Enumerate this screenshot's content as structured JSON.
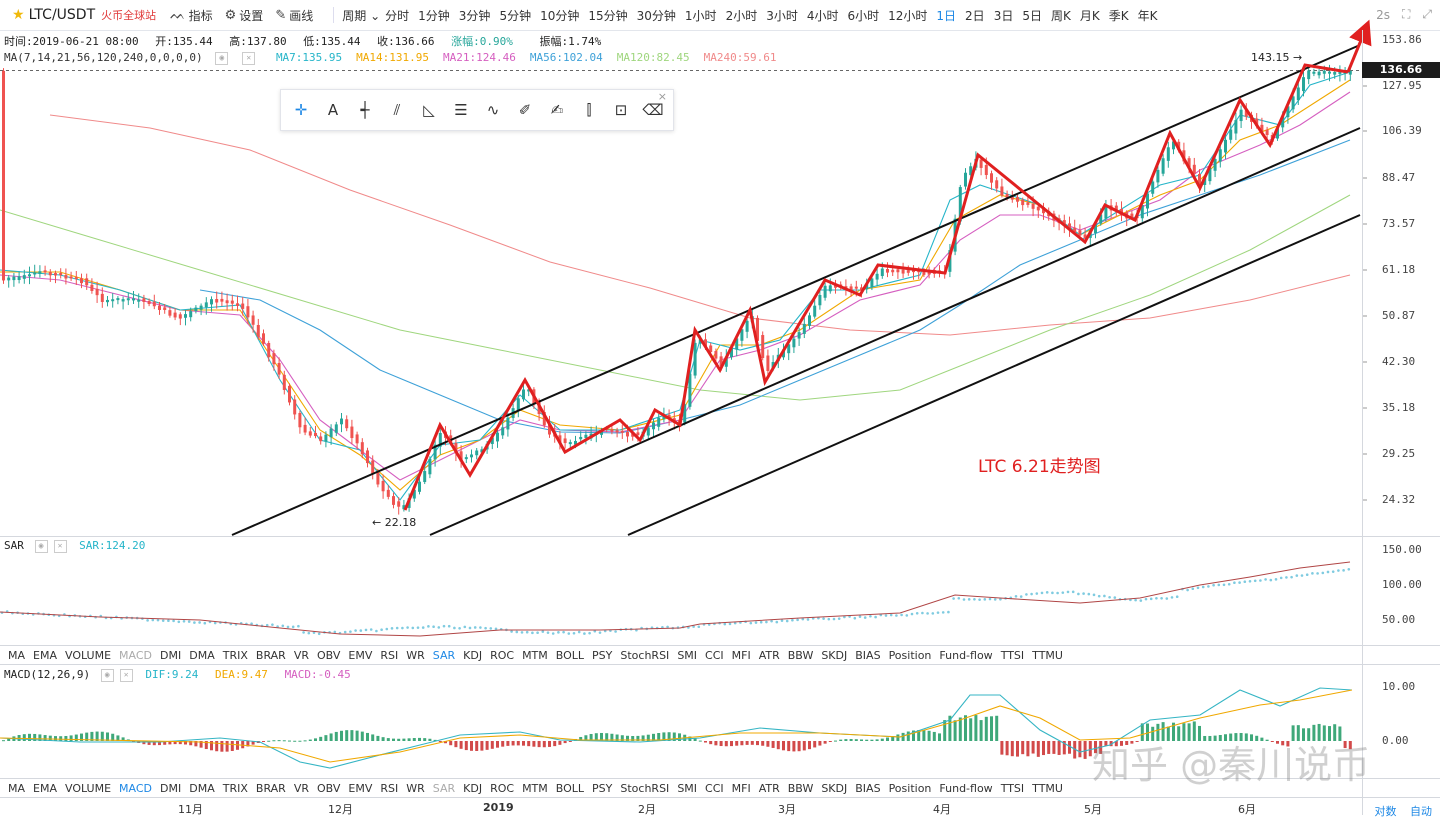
{
  "header": {
    "symbol": "LTC/USDT",
    "exchange": "火币全球站",
    "tools": [
      {
        "icon": "indicator-icon",
        "label": "指标"
      },
      {
        "icon": "gear-icon",
        "label": "设置"
      },
      {
        "icon": "pen-icon",
        "label": "画线"
      }
    ],
    "period_label": "周期",
    "intervals": [
      "分时",
      "1分钟",
      "3分钟",
      "5分钟",
      "10分钟",
      "15分钟",
      "30分钟",
      "1小时",
      "2小时",
      "3小时",
      "4小时",
      "6小时",
      "12小时",
      "1日",
      "2日",
      "3日",
      "5日",
      "周K",
      "月K",
      "季K",
      "年K"
    ],
    "active_interval": "1日",
    "refresh": "2s"
  },
  "ohlc": {
    "time": "时间:2019-06-21 08:00",
    "open": "开:135.44",
    "high": "高:137.80",
    "low": "低:135.44",
    "close": "收:136.66",
    "change": "涨幅:0.90%",
    "amplitude": "振幅:1.74%"
  },
  "ma_legend": {
    "params": "MA(7,14,21,56,120,240,0,0,0,0)",
    "items": [
      {
        "label": "MA7:135.95",
        "color": "#26b5c9"
      },
      {
        "label": "MA14:131.95",
        "color": "#f0a800"
      },
      {
        "label": "MA21:124.46",
        "color": "#d55fc0"
      },
      {
        "label": "MA56:102.04",
        "color": "#3ea1d8"
      },
      {
        "label": "MA120:82.45",
        "color": "#9fd67e"
      },
      {
        "label": "MA240:59.61",
        "color": "#f08a8a"
      }
    ]
  },
  "price_axis": [
    "153.86",
    "127.95",
    "106.39",
    "88.47",
    "73.57",
    "61.18",
    "50.87",
    "42.30",
    "35.18",
    "29.25",
    "24.32"
  ],
  "current_price": "136.66",
  "high_marker": "143.15 →",
  "low_marker": "← 22.18",
  "annotation": "LTC 6.21走势图",
  "sar": {
    "name": "SAR",
    "value_label": "SAR:124.20",
    "axis": [
      "150.00",
      "100.00",
      "50.00"
    ]
  },
  "macd": {
    "params": "MACD(12,26,9)",
    "dif": "DIF:9.24",
    "dea": "DEA:9.47",
    "macd": "MACD:-0.45",
    "axis": [
      "10.00",
      "0.00"
    ]
  },
  "indicator_tabs": [
    "MA",
    "EMA",
    "VOLUME",
    "MACD",
    "DMI",
    "DMA",
    "TRIX",
    "BRAR",
    "VR",
    "OBV",
    "EMV",
    "RSI",
    "WR",
    "SAR",
    "KDJ",
    "ROC",
    "MTM",
    "BOLL",
    "PSY",
    "StochRSI",
    "SMI",
    "CCI",
    "MFI",
    "ATR",
    "BBW",
    "SKDJ",
    "BIAS",
    "Position",
    "Fund-flow",
    "TTSI",
    "TTMU"
  ],
  "time_axis": [
    "11月",
    "12月",
    "2019",
    "2月",
    "3月",
    "4月",
    "5月",
    "6月"
  ],
  "bottom_right": [
    "对数",
    "自动"
  ],
  "watermark": "知乎 @秦川说币",
  "colors": {
    "up": "#26a69a",
    "down": "#ef5350",
    "accent": "#1e88e5",
    "trend": "#e02020"
  }
}
